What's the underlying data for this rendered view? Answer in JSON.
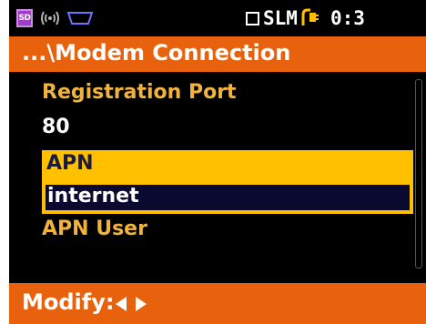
{
  "status_bar": {
    "sd_label": "SD",
    "mode_label": "SLM",
    "time": "0:3"
  },
  "title": "...\\Modem Connection",
  "fields": {
    "registration_port_label": "Registration Port",
    "registration_port_value": "80",
    "apn_label": "APN",
    "apn_value": "internet",
    "apn_user_label": "APN User"
  },
  "bottom_bar": {
    "modify_label": "Modify:"
  },
  "colors": {
    "accent_orange": "#e8620e",
    "label_gold": "#f0b43c",
    "highlight_yellow": "#ffc000",
    "selected_bg": "#0a0a30"
  }
}
